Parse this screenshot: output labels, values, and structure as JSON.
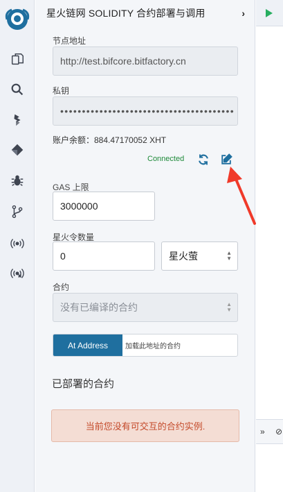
{
  "panel": {
    "title": "星火链网 SOLIDITY 合约部署与调用",
    "collapse_icon": "chevron-right-icon"
  },
  "node": {
    "label": "节点地址",
    "value": "http://test.bifcore.bitfactory.cn"
  },
  "private_key": {
    "label": "私钥",
    "value": "••••••••••••••••••••••••••••••••••••••••"
  },
  "account": {
    "balance_text": "账户余额：884.47170052 XHT",
    "status": "Connected",
    "refresh_icon": "refresh-icon",
    "edit_icon": "edit-icon"
  },
  "gas": {
    "label": "GAS 上限",
    "value": "3000000"
  },
  "token": {
    "label": "星火令数量",
    "value": "0",
    "unit": "星火萤"
  },
  "contract": {
    "label": "合约",
    "value": "没有已编译的合约"
  },
  "at_address": {
    "button_label": "At Address",
    "placeholder": "加载此地址的合约"
  },
  "deployed": {
    "title": "已部署的合约",
    "empty_message": "当前您没有可交互的合约实例."
  },
  "activity_bar": [
    "file-explorer-icon",
    "search-icon",
    "compile-icon",
    "deploy-icon",
    "debug-icon",
    "git-icon",
    "broadcast-icon",
    "broadcast-remove-icon"
  ],
  "colors": {
    "accent": "#1f6f9f",
    "connected": "#1e8a3a",
    "alert_bg": "#f4ddd4",
    "alert_text": "#c44a2a",
    "annotation_arrow": "#f03a2a"
  }
}
